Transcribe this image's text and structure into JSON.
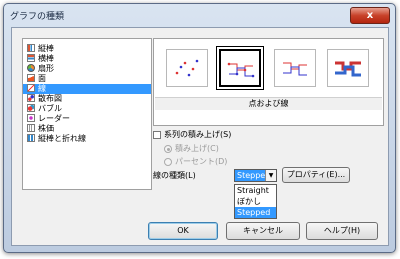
{
  "window": {
    "title": "グラフの種類",
    "close_label": "x"
  },
  "chart_types": [
    {
      "icon": "bar-chart-icon",
      "label": "縦棒"
    },
    {
      "icon": "horizontal-bar-chart-icon",
      "label": "横棒"
    },
    {
      "icon": "pie-chart-icon",
      "label": "扇形"
    },
    {
      "icon": "area-chart-icon",
      "label": "面"
    },
    {
      "icon": "line-chart-icon",
      "label": "線",
      "selected": true
    },
    {
      "icon": "scatter-chart-icon",
      "label": "散布図"
    },
    {
      "icon": "bubble-chart-icon",
      "label": "バブル"
    },
    {
      "icon": "radar-chart-icon",
      "label": "レーダー"
    },
    {
      "icon": "stock-chart-icon",
      "label": "株価"
    },
    {
      "icon": "bar-and-line-chart-icon",
      "label": "縦棒と折れ線"
    }
  ],
  "variants": {
    "caption": "点および線",
    "items": [
      "points-only",
      "points-and-lines",
      "lines-only",
      "3d-lines"
    ],
    "selected_index": 1
  },
  "options": {
    "stack_series": "系列の積み上げ(S)",
    "stack_on_top": "積み上げ(C)",
    "percent": "パーセント(D)",
    "line_type_label": "線の種類(L)",
    "line_type_value": "Stepped",
    "properties_button": "プロパティ(E)...",
    "line_type_options": [
      "Straight",
      "ぼかし",
      "Stepped"
    ]
  },
  "buttons": {
    "ok": "OK",
    "cancel": "キャンセル",
    "help": "ヘルプ(H)"
  },
  "colors": {
    "accent": "#3399ff",
    "close": "#c8422a"
  }
}
